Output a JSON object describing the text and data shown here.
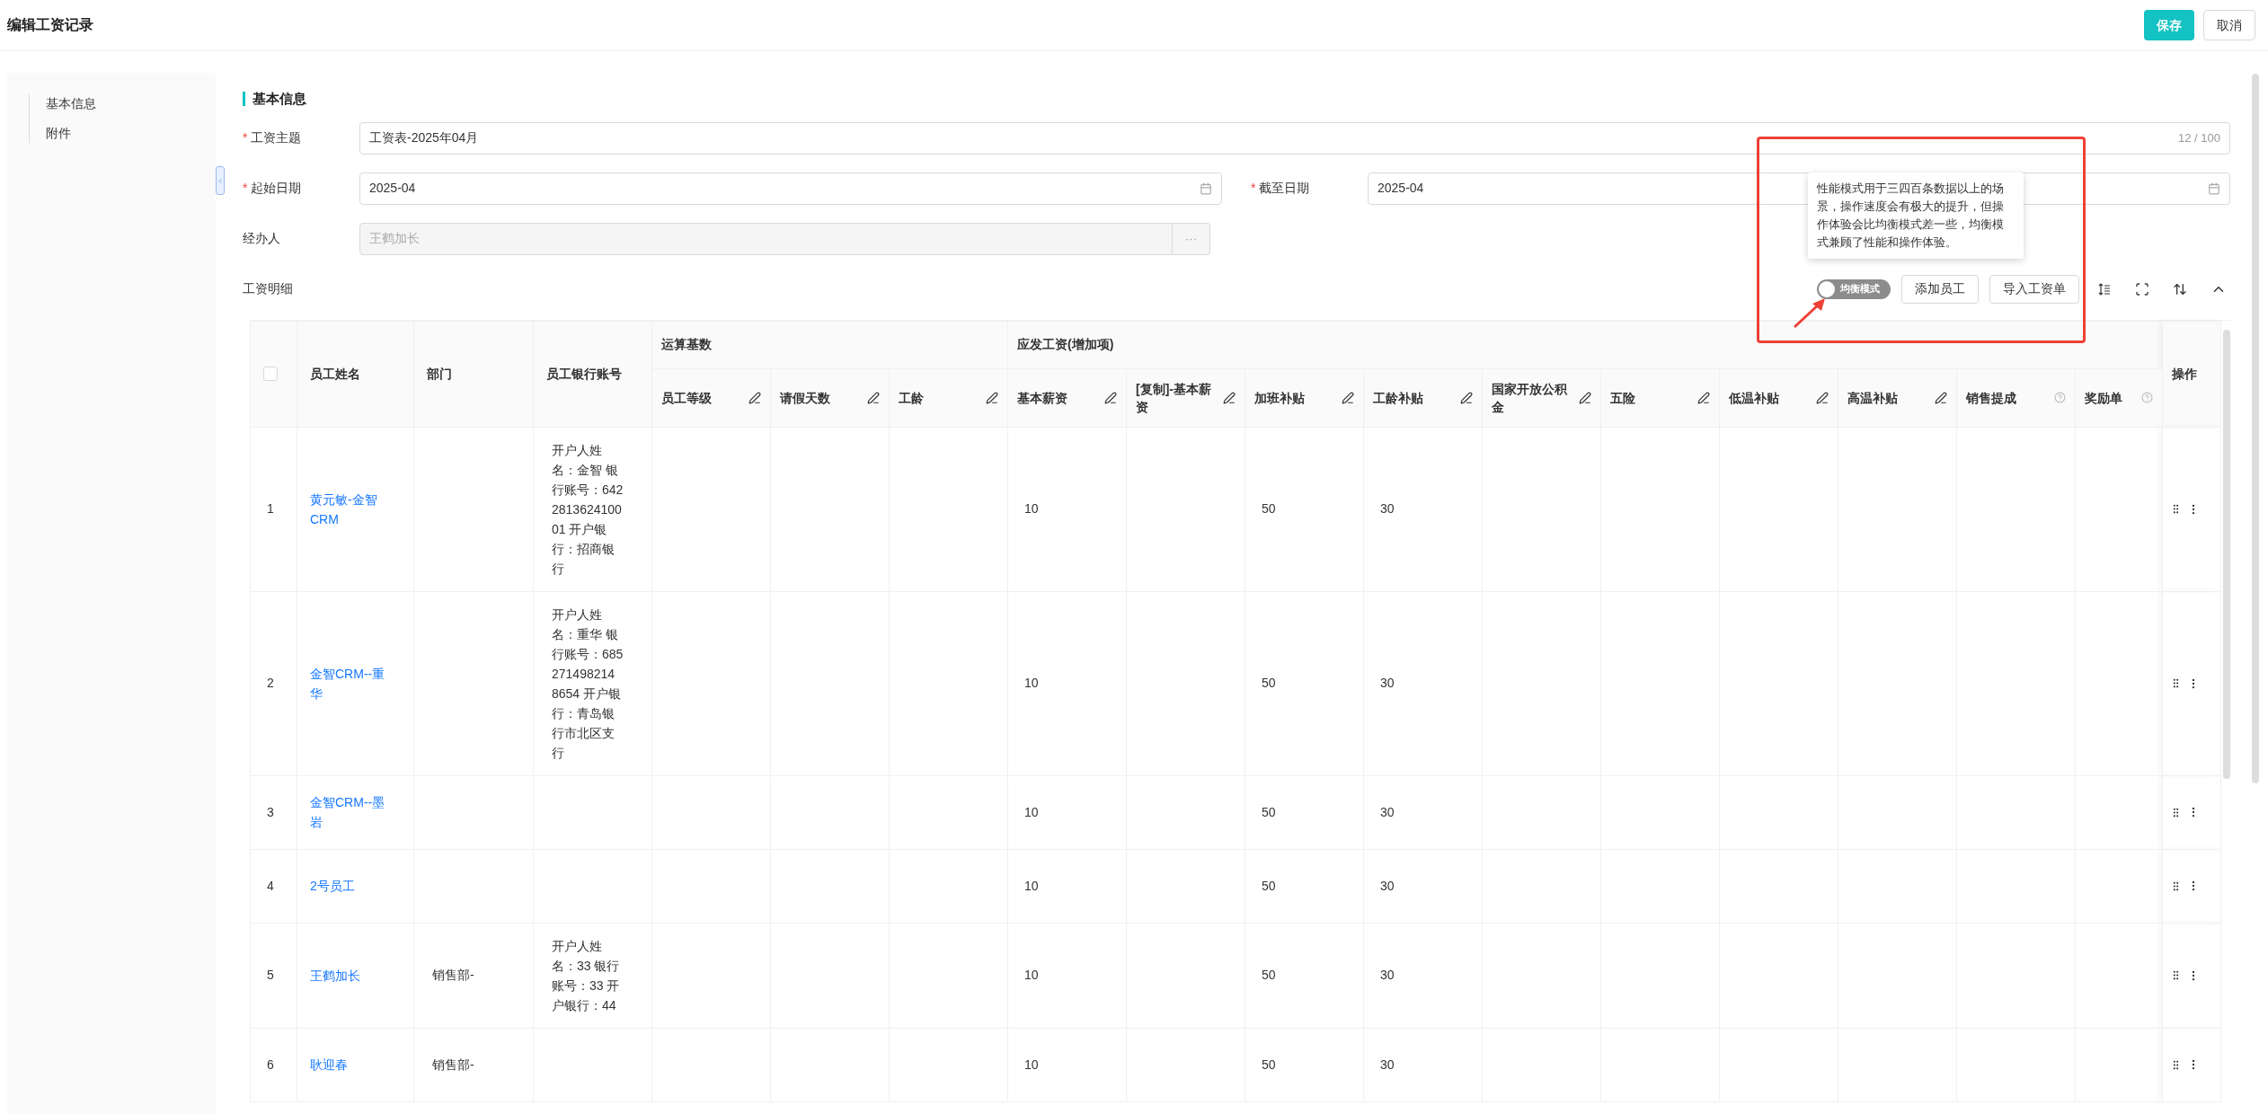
{
  "header": {
    "title": "编辑工资记录",
    "buttons": [
      {
        "label": "保存",
        "kind": "primary"
      },
      {
        "label": "取消",
        "kind": "default"
      }
    ]
  },
  "sidebar": {
    "items": [
      "基本信息",
      "附件"
    ]
  },
  "section_title": "基本信息",
  "form_rows": [
    [
      {
        "label": "工资主题",
        "marker": "*",
        "kind": "text",
        "value": "工资表-2025年04月",
        "counter": "12 / 100"
      }
    ],
    [
      {
        "label": "起始日期",
        "marker": "*",
        "kind": "date",
        "value": "2025-04"
      },
      {
        "label": "截至日期",
        "marker": "*",
        "kind": "date",
        "value": "2025-04"
      }
    ],
    [
      {
        "label": "经办人",
        "kind": "picker",
        "value": "王鹤加长",
        "disabled": true,
        "button": "···"
      }
    ]
  ],
  "details": {
    "label": "工资明细",
    "mode_switch": {
      "label": "均衡模式",
      "on": false
    },
    "buttons": [
      "添加员工",
      "导入工资单"
    ]
  },
  "tooltip": "性能模式用于三四百条数据以上的场景，操作速度会有极大的提升，但操作体验会比均衡模式差一些，均衡模式兼顾了性能和操作体验。",
  "table": {
    "columns": [
      {
        "kind": "check",
        "checked": false
      },
      {
        "kind": "single",
        "label": "员工姓名"
      },
      {
        "kind": "single",
        "label": "部门"
      },
      {
        "kind": "single",
        "label": "员工银行账号"
      }
    ],
    "groups": [
      {
        "label": "运算基数",
        "children": [
          {
            "label": "员工等级",
            "kind": "edit"
          },
          {
            "label": "请假天数",
            "kind": "edit"
          },
          {
            "label": "工龄",
            "kind": "edit"
          }
        ]
      },
      {
        "label": "应发工资(增加项)",
        "children": [
          {
            "label": "基本薪资",
            "kind": "edit"
          },
          {
            "label": "[复制]-基本薪资",
            "kind": "edit"
          },
          {
            "label": "加班补贴",
            "kind": "edit"
          },
          {
            "label": "工龄补贴",
            "kind": "edit"
          },
          {
            "label": "国家开放公积金",
            "kind": "edit"
          },
          {
            "label": "五险",
            "kind": "edit"
          },
          {
            "label": "低温补贴",
            "kind": "edit"
          },
          {
            "label": "高温补贴",
            "kind": "edit"
          },
          {
            "label": "销售提成",
            "kind": "help"
          },
          {
            "label": "奖励单",
            "kind": "help"
          }
        ]
      }
    ],
    "action_column": "操作",
    "rows": [
      {
        "index": "1",
        "name": "黄元敏-金智CRM",
        "bank": "开户人姓名：金智 银行账号：642281362410001 开户银行：招商银行",
        "base_salary": "10",
        "overtime_allowance": "50",
        "seniority_allowance": "30"
      },
      {
        "index": "2",
        "name": "金智CRM--重华",
        "bank": "开户人姓名：重华 银行账号：685271498214 8654 开户银行：青岛银行市北区支行",
        "base_salary": "10",
        "overtime_allowance": "50",
        "seniority_allowance": "30"
      },
      {
        "index": "3",
        "name": "金智CRM--墨岩",
        "base_salary": "10",
        "overtime_allowance": "50",
        "seniority_allowance": "30"
      },
      {
        "index": "4",
        "name": "2号员工",
        "base_salary": "10",
        "overtime_allowance": "50",
        "seniority_allowance": "30"
      },
      {
        "index": "5",
        "name": "王鹤加长",
        "dept": "销售部-",
        "bank": "开户人姓名：33 银行账号：33 开户银行：44",
        "base_salary": "10",
        "overtime_allowance": "50",
        "seniority_allowance": "30"
      },
      {
        "index": "6",
        "name": "耿迎春",
        "dept": "销售部-",
        "base_salary": "10",
        "overtime_allowance": "50",
        "seniority_allowance": "30"
      }
    ]
  }
}
